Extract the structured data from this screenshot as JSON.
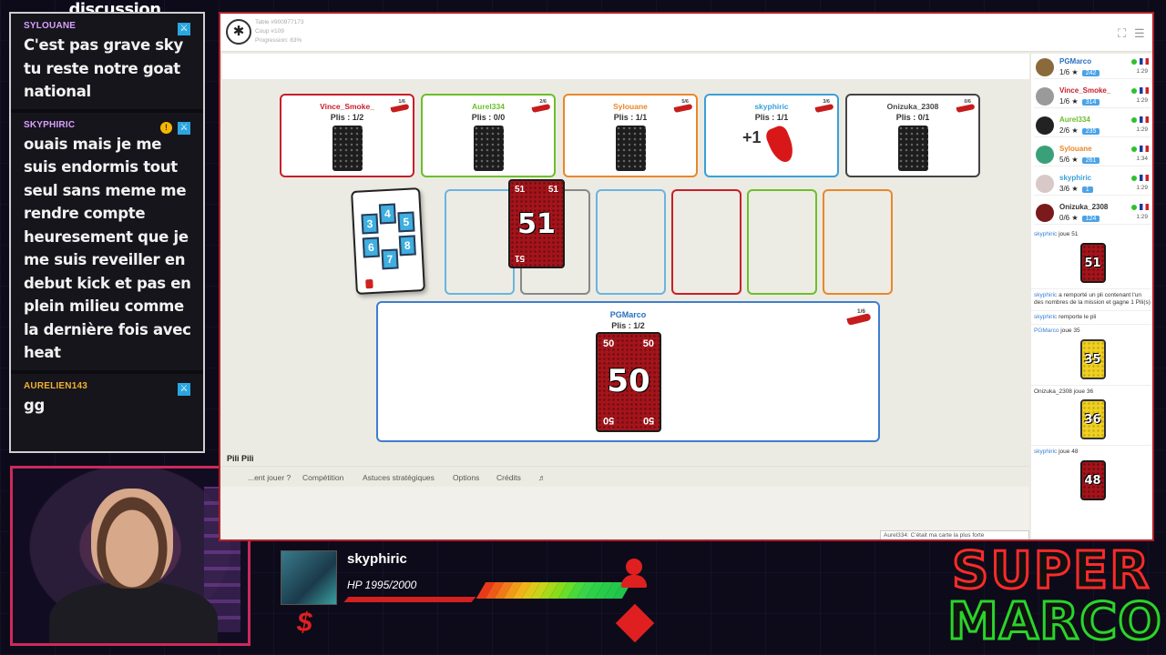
{
  "chat": {
    "title": "discussion",
    "messages": [
      {
        "user": "SYLOUANE",
        "text": "C'est pas grave sky tu reste notre goat national"
      },
      {
        "user": "SKYPHIRIC",
        "text": "ouais mais je me suis endormis tout seul sans meme me rendre compte heuresement que je me suis reveiller en debut kick et pas en plein milieu comme la dernière fois avec heat"
      },
      {
        "user": "AURELIEN143",
        "text": "gg"
      }
    ]
  },
  "game": {
    "table_info": [
      "Table #900977173",
      "Coup #109",
      "Progression: 83%"
    ],
    "title": "Pili Pili",
    "nav": [
      "...ent jouer ?",
      "Compétition",
      "Astuces stratégiques",
      "Options",
      "Crédits",
      "♬"
    ],
    "seats": [
      {
        "name": "Vince_Smoke_",
        "tricks": "Plis : 1/2",
        "badge": "1/6",
        "color": "#c81e2a"
      },
      {
        "name": "Aurel334",
        "tricks": "Plis : 0/0",
        "badge": "2/6",
        "color": "#6cbf2a"
      },
      {
        "name": "Sylouane",
        "tricks": "Plis : 1/1",
        "badge": "5/6",
        "color": "#e8872a"
      },
      {
        "name": "skyphiric",
        "tricks": "Plis : 1/1",
        "badge": "3/6",
        "color": "#3aa0d8",
        "bonus": "+1"
      },
      {
        "name": "Onizuka_2308",
        "tricks": "Plis : 0/1",
        "badge": "0/6",
        "color": "#444444"
      }
    ],
    "mission_numbers": [
      "3",
      "4",
      "5",
      "6",
      "7",
      "8"
    ],
    "played_card": {
      "value": "51",
      "corner": "51"
    },
    "player": {
      "name": "PGMarco",
      "tricks": "Plis : 1/2",
      "badge": "1/6",
      "hand_card": "50"
    },
    "footer_message": "Aurel334: C'était ma carte la plus forte",
    "pile_colors": [
      "#6ab4e0",
      "#888888",
      "#6ab4e0",
      "#c81e2a",
      "#6cbf2a",
      "#e8872a"
    ]
  },
  "players_panel": [
    {
      "name": "PGMarco",
      "score": "1/6",
      "elo": "242",
      "time": "1:29",
      "color": "#2a6ec0"
    },
    {
      "name": "Vince_Smoke_",
      "score": "1/6",
      "elo": "314",
      "time": "1:29",
      "color": "#c81e2a"
    },
    {
      "name": "Aurel334",
      "score": "2/6",
      "elo": "235",
      "time": "1:29",
      "color": "#6cbf2a"
    },
    {
      "name": "Sylouane",
      "score": "5/6",
      "elo": "261",
      "time": "1:34",
      "color": "#e8872a"
    },
    {
      "name": "skyphiric",
      "score": "3/6",
      "elo": "1",
      "time": "1:29",
      "color": "#3aa0d8"
    },
    {
      "name": "Onizuka_2308",
      "score": "0/6",
      "elo": "124",
      "time": "1:29",
      "color": "#333333"
    }
  ],
  "log": {
    "line1_user": "skyphiric",
    "line1_text": " joue 51",
    "card1": "51",
    "line2_user": "skyphiric",
    "line2_text": " a remporté un pli contenant l'un des nombres de la mission et gagne 1 Pili(s)",
    "line3_user": "skyphiric",
    "line3_text": " remporte le pli",
    "line4_user": "PGMarco",
    "line4_text": " joue 35",
    "card4": "35",
    "line5_user": "Onizuka_2308",
    "line5_text": " joue 36",
    "card5": "36",
    "line6_user": "skyphiric",
    "line6_text": " joue 48",
    "card6": "48"
  },
  "hud": {
    "name": "skyphiric",
    "hp": "HP 1995/2000",
    "hp_fraction": 0.9975,
    "dollar": "$",
    "logo_line1": "SUPER",
    "logo_line2": "MARCO"
  }
}
